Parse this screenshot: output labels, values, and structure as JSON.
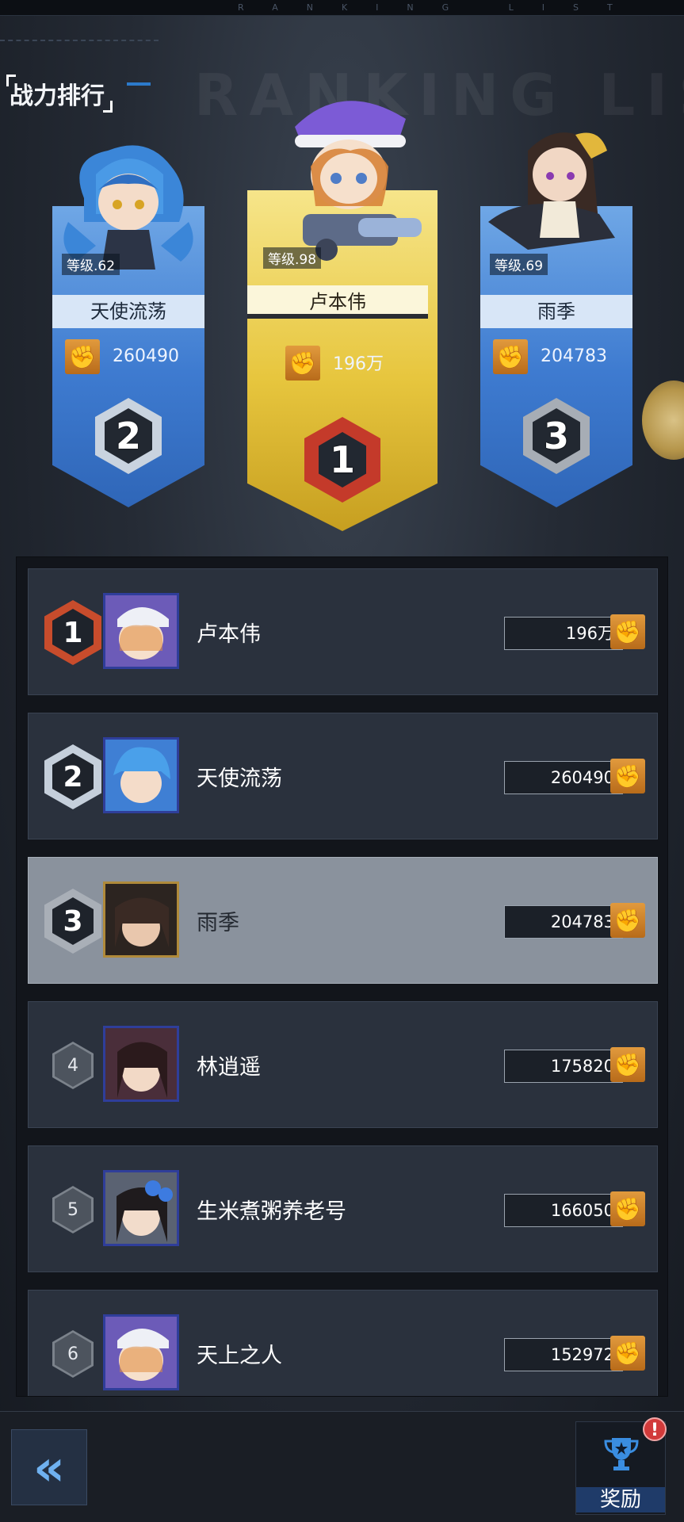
{
  "header": {
    "watermark": "RANKING LIST",
    "strip_text": "RANKING LIST",
    "title": "战力排行"
  },
  "podium": [
    {
      "rank": "2",
      "level": "等级.62",
      "name": "天使流荡",
      "power": "260490",
      "medal_color": "#b9c6d6"
    },
    {
      "rank": "1",
      "level": "等级.98",
      "name": "卢本伟",
      "power": "196万",
      "medal_color": "#c43a2a"
    },
    {
      "rank": "3",
      "level": "等级.69",
      "name": "雨季",
      "power": "204783",
      "medal_color": "#9aa0a8"
    }
  ],
  "power_icon": "fist-icon",
  "list": [
    {
      "rank": "1",
      "name": "卢本伟",
      "power": "196万"
    },
    {
      "rank": "2",
      "name": "天使流荡",
      "power": "260490"
    },
    {
      "rank": "3",
      "name": "雨季",
      "power": "204783"
    },
    {
      "rank": "4",
      "name": "林逍遥",
      "power": "175820"
    },
    {
      "rank": "5",
      "name": "生米煮粥养老号",
      "power": "166050"
    },
    {
      "rank": "6",
      "name": "天上之人",
      "power": "152972"
    }
  ],
  "bottom": {
    "back_icon": "double-chevron-left-icon",
    "reward_label": "奖励",
    "reward_alert": "!"
  },
  "colors": {
    "accent_blue": "#3e7bd0",
    "gold": "#e7c63e",
    "power_orange": "#e19a3d"
  }
}
